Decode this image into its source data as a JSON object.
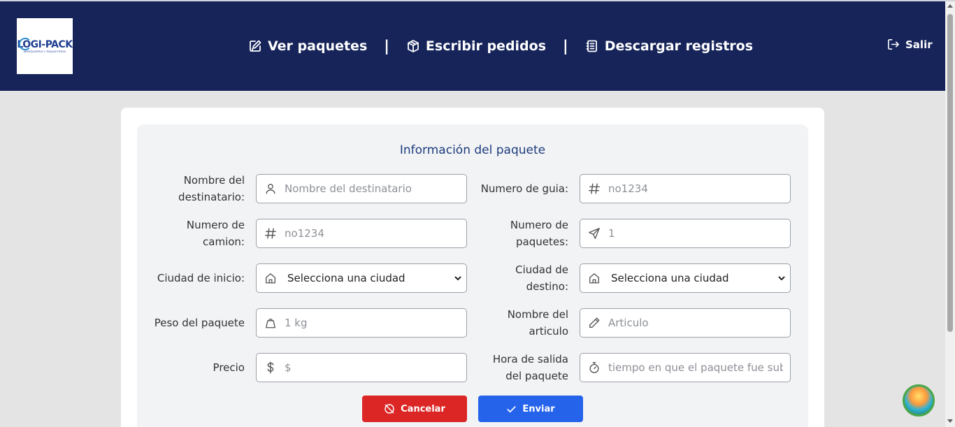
{
  "header": {
    "logo_text": "LOGI-PACK",
    "logo_subtext": "MENSAJERIA Y PAQUETERIA",
    "nav": [
      {
        "label": "Ver paquetes",
        "icon": "edit-note-icon"
      },
      {
        "label": "Escribir pedidos",
        "icon": "package-icon"
      },
      {
        "label": "Descargar registros",
        "icon": "notebook-icon"
      }
    ],
    "separator": "|",
    "logout_label": "Salir"
  },
  "form": {
    "title": "Información del paquete",
    "fields": {
      "recipient": {
        "label_1": "Nombre del",
        "label_2": "destinatario:",
        "placeholder": "Nombre del destinatario",
        "icon": "user-icon"
      },
      "guide": {
        "label_1": "Numero de guia:",
        "placeholder": "no1234",
        "icon": "hash-icon"
      },
      "truck": {
        "label_1": "Numero de",
        "label_2": "camion:",
        "placeholder": "no1234",
        "icon": "hash-icon"
      },
      "packages": {
        "label_1": "Numero de",
        "label_2": "paquetes:",
        "placeholder": "1",
        "icon": "send-icon"
      },
      "origin": {
        "label_1": "Ciudad de inicio:",
        "value": "Selecciona una ciudad",
        "icon": "home-icon"
      },
      "destination": {
        "label_1": "Ciudad de",
        "label_2": "destino:",
        "value": "Selecciona una ciudad",
        "icon": "home-icon"
      },
      "weight": {
        "label_1": "Peso del paquete",
        "placeholder": "1 kg",
        "icon": "weight-icon"
      },
      "article": {
        "label_1": "Nombre del",
        "label_2": "articulo",
        "placeholder": "Articulo",
        "icon": "pencil-icon"
      },
      "price": {
        "label_1": "Precio",
        "placeholder": "$",
        "icon": "dollar-icon"
      },
      "departure": {
        "label_1": "Hora de salida",
        "label_2": "del paquete",
        "placeholder": "tiempo en que el paquete fue subi",
        "icon": "stopwatch-icon"
      }
    },
    "cancel_label": "Cancelar",
    "send_label": "Enviar"
  },
  "colors": {
    "header_bg": "#16245a",
    "title_color": "#1c3c7c",
    "cancel_bg": "#dc2626",
    "send_bg": "#2563eb"
  }
}
